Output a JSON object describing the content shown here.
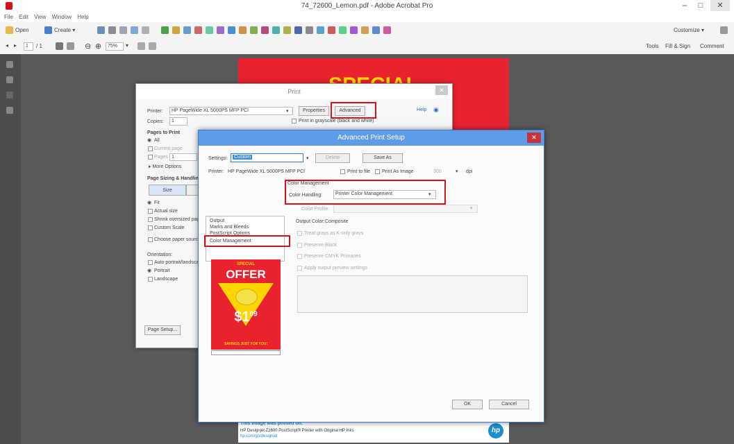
{
  "window": {
    "title": "74_72600_Lemon.pdf - Adobe Acrobat Pro",
    "minimize": "–",
    "maximize": "□",
    "close": "✕"
  },
  "menu": [
    "File",
    "Edit",
    "View",
    "Window",
    "Help"
  ],
  "toolbar": {
    "open_label": "Open",
    "create_label": "Create ▾",
    "customize_label": "Customize ▾",
    "page_current": "1",
    "page_total": "/ 1",
    "zoom": "75%",
    "tools_label": "Tools",
    "fill_sign_label": "Fill & Sign",
    "comment_label": "Comment"
  },
  "poster": {
    "headline": "SPECIAL",
    "footer_line1": "This image was printed on:",
    "footer_line2": "HP Designjet Z2600 PostScript® Printer with Original HP Inks",
    "footer_line3": "hp.com/go/designjet",
    "logo": "hp"
  },
  "print_dialog": {
    "title": "Print",
    "close": "✕",
    "printer_label": "Printer:",
    "printer_value": "HP PageWide XL 5000PS MFP PCl",
    "properties_label": "Properties",
    "advanced_label": "Advanced",
    "help_label": "Help",
    "copies_label": "Copies:",
    "copies_value": "1",
    "print_grayscale_label": "Print in grayscale (black and white)",
    "pages_to_print_label": "Pages to Print",
    "all_label": "All",
    "current_page_label": "Current page",
    "pages_label": "Pages",
    "pages_value": "1",
    "more_options_label": "▸ More Options",
    "page_sizing_label": "Page Sizing & Handling",
    "size_label": "Size",
    "fit_label": "Fit",
    "actual_size_label": "Actual size",
    "shrink_label": "Shrink oversized pages",
    "custom_scale_label": "Custom Scale",
    "choose_paper_label": "Choose paper source by PDF page size",
    "orientation_label": "Orientation:",
    "auto_orient_label": "Auto portrait/landscape",
    "portrait_label": "Portrait",
    "landscape_label": "Landscape",
    "page_setup_label": "Page Setup..."
  },
  "advanced_dialog": {
    "title": "Advanced Print Setup",
    "close": "✕",
    "settings_label": "Settings:",
    "settings_value": "Custom",
    "delete_label": "Delete",
    "save_as_label": "Save As",
    "printer_label": "Printer:",
    "printer_value": "HP PageWide XL 5000PS MFP PCl",
    "print_to_file_label": "Print to file",
    "print_as_image_label": "Print As Image",
    "dpi_value": "300",
    "dpi_label": "dpi",
    "categories": [
      "Output",
      "Marks and Bleeds",
      "PostScript Options",
      "Color Management"
    ],
    "color_management_heading": "Color Management",
    "color_handling_label": "Color Handling:",
    "color_handling_value": "Printer Color Management",
    "color_profile_label": "Color Profile:",
    "output_color_label": "Output Color:",
    "output_color_value": "Composite",
    "treat_grays_label": "Treat grays as K-only grays",
    "preserve_black_label": "Preserve Black",
    "preserve_cmyk_label": "Preserve CMYK Primaries",
    "apply_output_label": "Apply output preview settings",
    "ok_label": "OK",
    "cancel_label": "Cancel"
  },
  "preview": {
    "special": "SPECIAL",
    "offer": "OFFER",
    "price_main": "$1",
    "price_cents": "99",
    "savings": "SAVINGS JUST FOR YOU!"
  }
}
